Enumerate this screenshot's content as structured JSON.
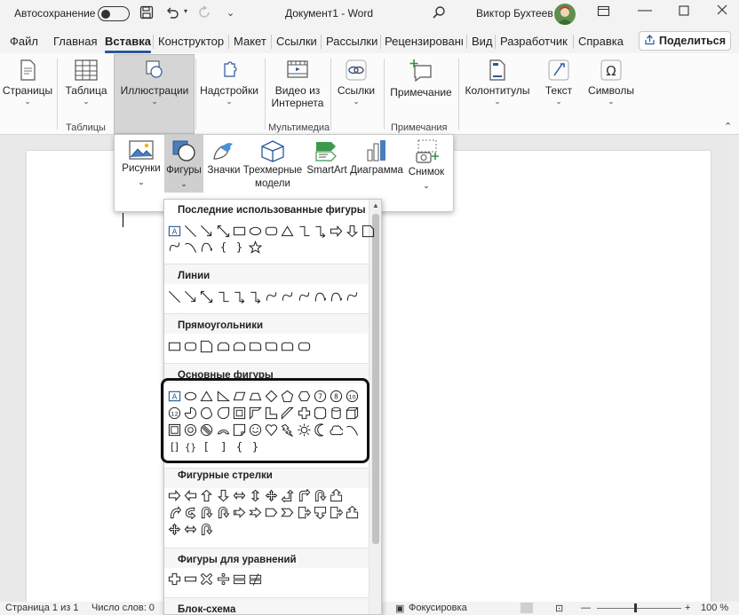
{
  "titlebar": {
    "autosave": "Автосохранение",
    "doc_title": "Документ1 - Word",
    "user": "Виктор Бухтеев"
  },
  "tabs": [
    "Файл",
    "Главная",
    "Вставка",
    "Конструктор",
    "Макет",
    "Ссылки",
    "Рассылки",
    "Рецензировани",
    "Вид",
    "Разработчик",
    "Справка"
  ],
  "share_label": "Поделиться",
  "ribbon": {
    "pages": "Страницы",
    "table": "Таблица",
    "tables_group": "Таблицы",
    "illustrations": "Иллюстрации",
    "addins": "Надстройки",
    "video_l1": "Видео из",
    "video_l2": "Интернета",
    "media_group": "Мультимедиа",
    "links": "Ссылки",
    "comment": "Примечание",
    "comments_group": "Примечания",
    "headers": "Колонтитулы",
    "text": "Текст",
    "symbols": "Символы"
  },
  "illus_popup": {
    "pictures": "Рисунки",
    "shapes": "Фигуры",
    "icons": "Значки",
    "models_l1": "Трехмерные",
    "models_l2": "модели",
    "smartart": "SmartArt",
    "chart": "Диаграмма",
    "screenshot": "Снимок"
  },
  "shapes_panel": {
    "recent": "Последние использованные фигуры",
    "lines": "Линии",
    "rects": "Прямоугольники",
    "basic": "Основные фигуры",
    "arrows": "Фигурные стрелки",
    "equation": "Фигуры для уравнений",
    "flowchart": "Блок-схема"
  },
  "status": {
    "page": "Страница 1 из 1",
    "words": "Число слов: 0",
    "focus": "Фокусировка",
    "zoom": "100 %"
  },
  "colors": {
    "accent": "#2b579a",
    "shape_stroke": "#222222",
    "selected_bg": "#cfcfcf"
  }
}
